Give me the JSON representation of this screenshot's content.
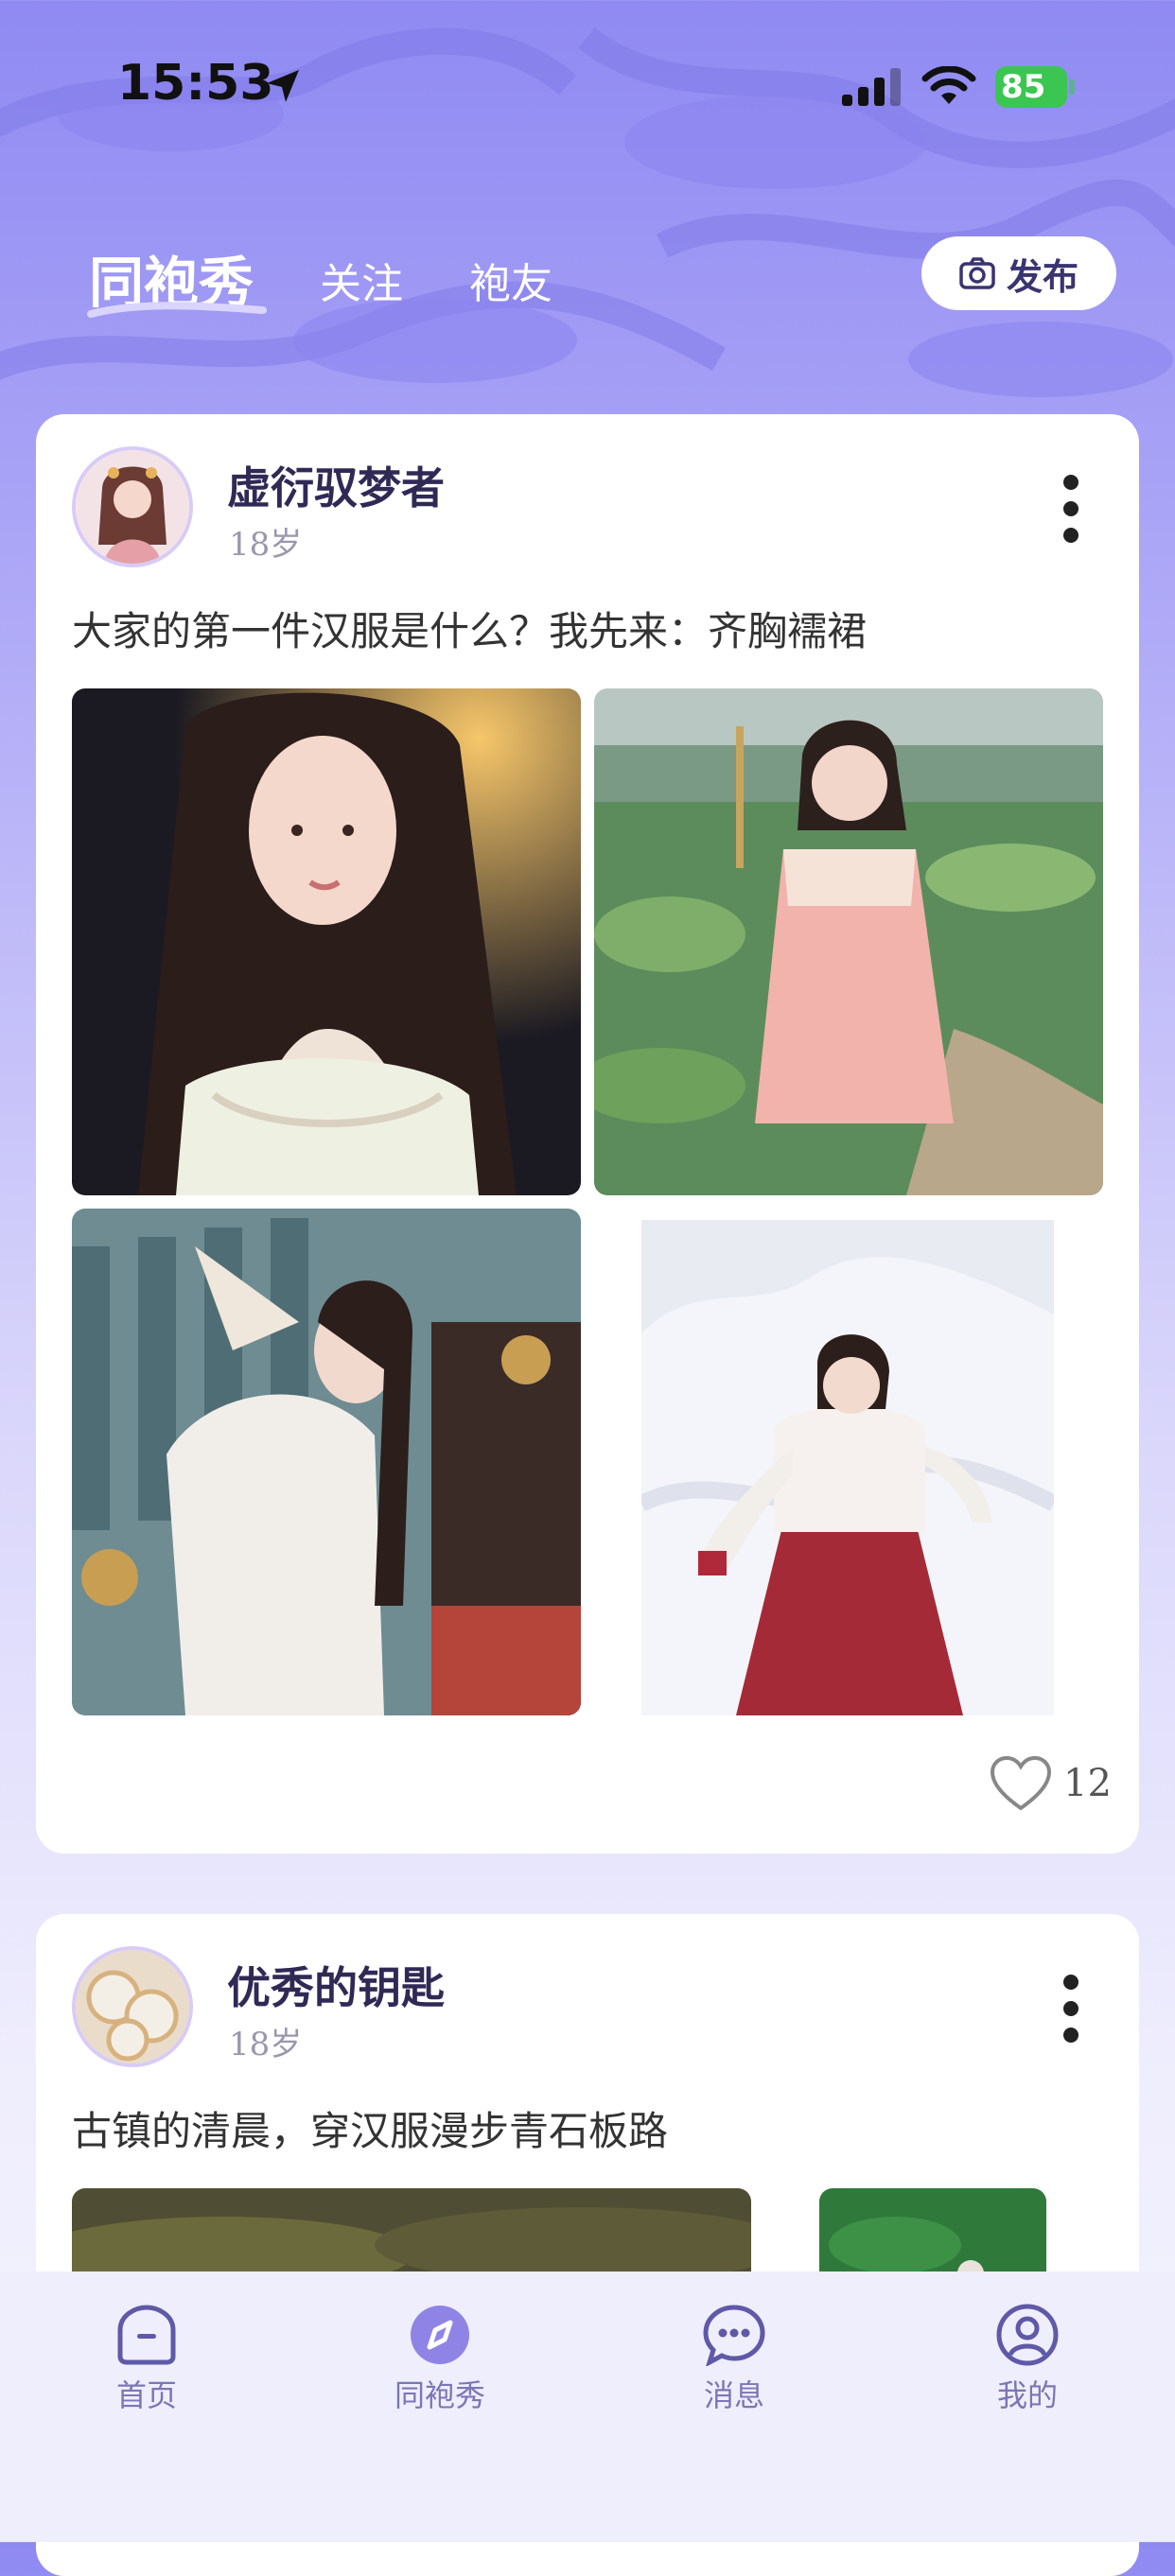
{
  "status_bar": {
    "time": "15:53",
    "battery": "85"
  },
  "header": {
    "tabs": [
      {
        "label": "同袍秀"
      },
      {
        "label": "关注"
      },
      {
        "label": "袍友"
      }
    ],
    "publish_label": "发布"
  },
  "posts": [
    {
      "username": "虚衍驭梦者",
      "age": "18岁",
      "text": "大家的第一件汉服是什么？我先来：齐胸襦裙",
      "likes": "12"
    },
    {
      "username": "优秀的钥匙",
      "age": "18岁",
      "text": "古镇的清晨，穿汉服漫步青石板路"
    }
  ],
  "bottom_nav": [
    {
      "label": "首页",
      "icon": "home-icon"
    },
    {
      "label": "同袍秀",
      "icon": "compass-icon"
    },
    {
      "label": "消息",
      "icon": "message-icon"
    },
    {
      "label": "我的",
      "icon": "profile-icon"
    }
  ],
  "colors": {
    "accent": "#8f8af2",
    "nav_active": "#8f84e6",
    "battery": "#3bc651"
  }
}
